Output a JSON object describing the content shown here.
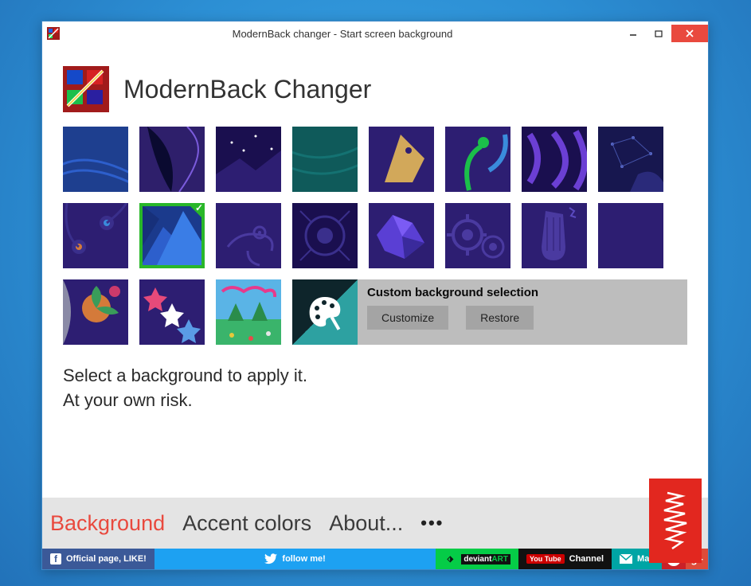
{
  "window": {
    "title": "ModernBack changer - Start screen background"
  },
  "app": {
    "title": "ModernBack Changer"
  },
  "backgrounds": {
    "selected_index": 9,
    "items": [
      "bg-blue-waves",
      "bg-leaves",
      "bg-stars",
      "bg-teal-plain",
      "bg-abstract-horse",
      "bg-plant-sprout",
      "bg-swirl-purple",
      "bg-dots-navy",
      "bg-flowers",
      "bg-blue-triangles",
      "bg-chameleon",
      "bg-fossil",
      "bg-crystal",
      "bg-gears",
      "bg-guitar",
      "bg-plain-purple",
      "bg-floral-orange",
      "bg-snowflakes",
      "bg-landscape"
    ]
  },
  "custom": {
    "title": "Custom background selection",
    "customize": "Customize",
    "restore": "Restore"
  },
  "instructions": {
    "line1": "Select a background to apply it.",
    "line2": "At your own risk."
  },
  "nav": {
    "background": "Background",
    "accent": "Accent colors",
    "about": "About...",
    "more": "•••"
  },
  "social": {
    "facebook": "Official page, LIKE!",
    "twitter": "follow me!",
    "deviant_prefix": "deviant",
    "deviant_suffix": "ART",
    "youtube_badge": "You Tube",
    "youtube": "Channel",
    "mail": "Mail"
  }
}
